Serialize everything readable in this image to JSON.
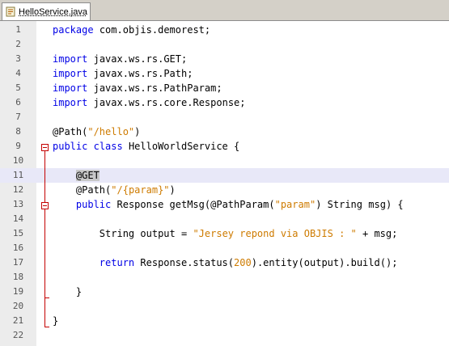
{
  "tab": {
    "label": "HelloService.java"
  },
  "lines": [
    {
      "n": "1",
      "t": "package com.objis.demorest;"
    },
    {
      "n": "2",
      "t": ""
    },
    {
      "n": "3",
      "t": "import javax.ws.rs.GET;"
    },
    {
      "n": "4",
      "t": "import javax.ws.rs.Path;"
    },
    {
      "n": "5",
      "t": "import javax.ws.rs.PathParam;"
    },
    {
      "n": "6",
      "t": "import javax.ws.rs.core.Response;"
    },
    {
      "n": "7",
      "t": ""
    },
    {
      "n": "8",
      "t": "@Path(\"/hello\")"
    },
    {
      "n": "9",
      "t": "public class HelloWorldService {"
    },
    {
      "n": "10",
      "t": ""
    },
    {
      "n": "11",
      "t": "    @GET"
    },
    {
      "n": "12",
      "t": "    @Path(\"/{param}\")"
    },
    {
      "n": "13",
      "t": "    public Response getMsg(@PathParam(\"param\") String msg) {"
    },
    {
      "n": "14",
      "t": ""
    },
    {
      "n": "15",
      "t": "        String output = \"Jersey repond via OBJIS : \" + msg;"
    },
    {
      "n": "16",
      "t": ""
    },
    {
      "n": "17",
      "t": "        return Response.status(200).entity(output).build();"
    },
    {
      "n": "18",
      "t": ""
    },
    {
      "n": "19",
      "t": "    }"
    },
    {
      "n": "20",
      "t": ""
    },
    {
      "n": "21",
      "t": "}"
    },
    {
      "n": "22",
      "t": ""
    }
  ],
  "colors": {
    "keyword": "#0000e6",
    "string": "#ce7b00",
    "fold": "#c40000",
    "current_line": "#e8e8f8"
  },
  "icons": {
    "tab": "java-file-icon",
    "fold": "fold-collapse-icon"
  }
}
